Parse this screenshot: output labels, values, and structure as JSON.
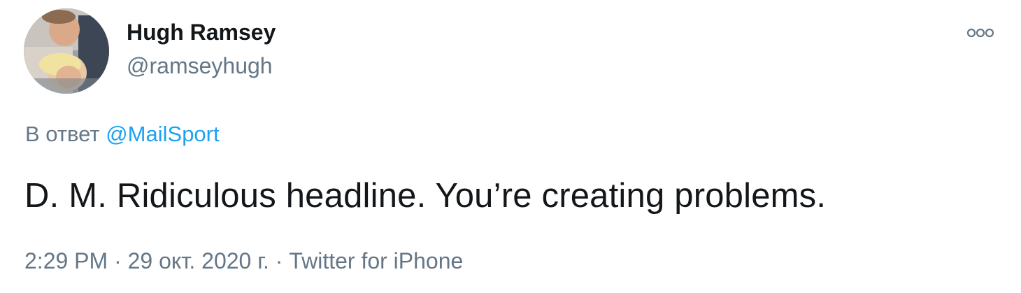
{
  "author": {
    "display_name": "Hugh Ramsey",
    "handle": "@ramseyhugh"
  },
  "more_icon": "more-horizontal-icon",
  "reply": {
    "prefix": "В ответ",
    "mention": "@MailSport"
  },
  "text": "D. M. Ridiculous headline. You’re creating problems.",
  "meta": {
    "time": "2:29 PM",
    "separator_1": " · ",
    "date": "29 окт. 2020 г.",
    "separator_2": " · ",
    "source": "Twitter for iPhone"
  },
  "colors": {
    "text_primary": "#14171a",
    "text_secondary": "#657786",
    "link": "#1da1f2",
    "background": "#ffffff"
  }
}
